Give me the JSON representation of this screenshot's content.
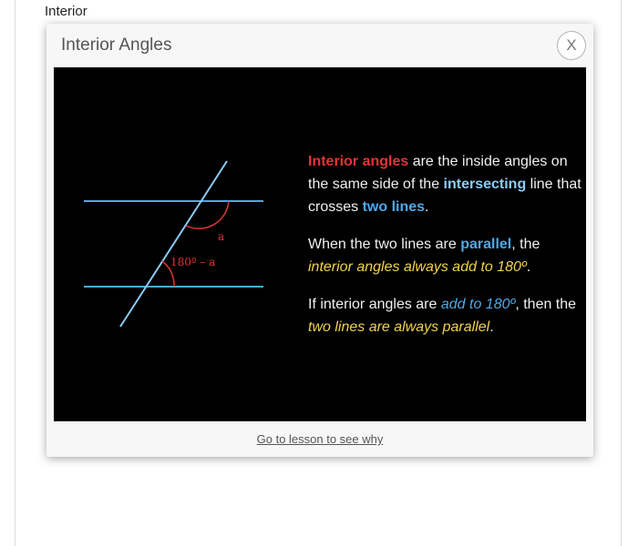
{
  "background": {
    "label": "Interior"
  },
  "modal": {
    "title": "Interior Angles",
    "close_label": "X",
    "footer_link": "Go to lesson to see why"
  },
  "diagram": {
    "angle_a_label": "a",
    "angle_b_label": "180º – a"
  },
  "explanation": {
    "p1": {
      "t1": "Interior angles",
      "t2": " are the inside angles on the same side of the ",
      "t3": "intersecting",
      "t4": " line that crosses ",
      "t5": "two lines",
      "t6": "."
    },
    "p2": {
      "t1": "When the two lines are ",
      "t2": "parallel",
      "t3": ", the ",
      "t4": "interior angles always add to 180º",
      "t5": "."
    },
    "p3": {
      "t1": "If interior angles are ",
      "t2": "add to 180º",
      "t3": ", then the ",
      "t4": "two lines are always parallel",
      "t5": "."
    }
  },
  "colors": {
    "red": "#e23535",
    "light_blue": "#8ccbf5",
    "blue": "#4ea8e8",
    "yellow": "#f0d24a"
  }
}
